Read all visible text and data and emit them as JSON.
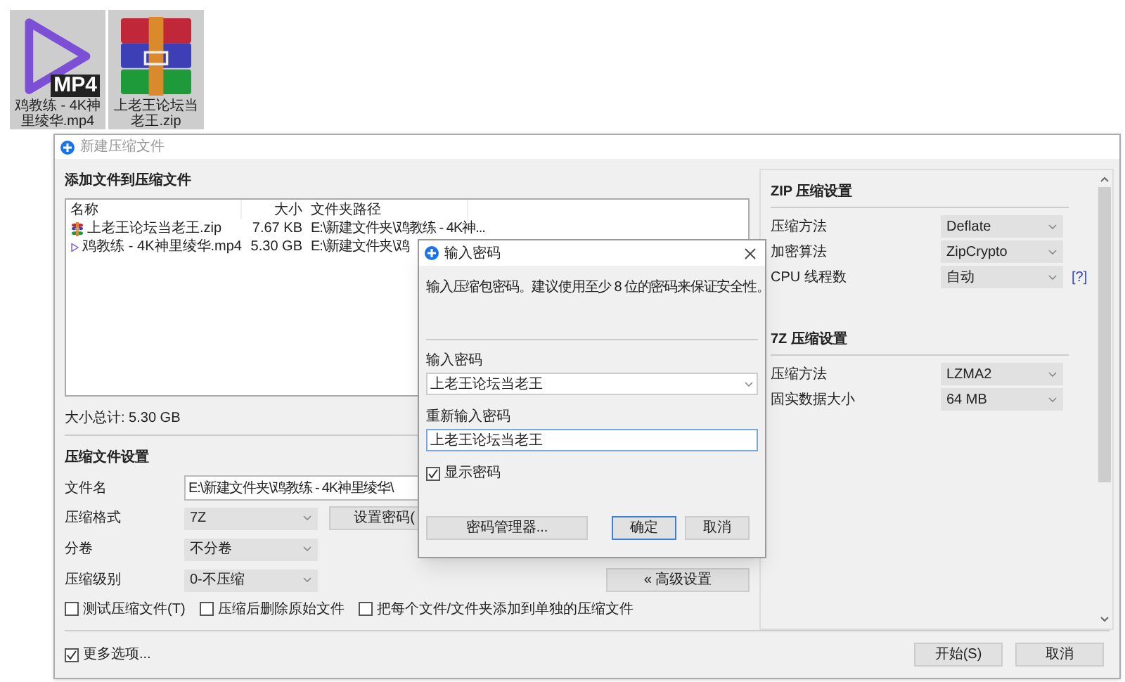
{
  "desktop_icons": [
    {
      "kind": "video",
      "badge": "MP4",
      "label": "鸡教练 - 4K神里绫华.mp4"
    },
    {
      "kind": "archive",
      "label": "上老王论坛当老王.zip"
    }
  ],
  "window": {
    "title": "新建压缩文件",
    "active": false
  },
  "files": {
    "heading": "添加文件到压缩文件",
    "columns": [
      "名称",
      "大小",
      "文件夹路径"
    ],
    "rows": [
      {
        "kind": "archive",
        "name": "上老王论坛当老王.zip",
        "size": "7.67 KB",
        "path": "E:\\新建文件夹\\鸡教练 - 4K神..."
      },
      {
        "kind": "video",
        "name": "鸡教练 - 4K神里绫华.mp4",
        "size": "5.30 GB",
        "path": "E:\\新建文件夹\\鸡"
      }
    ],
    "total": "大小总计: 5.30 GB"
  },
  "archive_settings": {
    "heading": "压缩文件设置",
    "filename_label": "文件名",
    "filename": "E:\\新建文件夹\\鸡教练 - 4K神里绫华\\",
    "selects": [
      {
        "label": "压缩格式",
        "value": "7Z"
      },
      {
        "label": "分卷",
        "value": "不分卷"
      },
      {
        "label": "压缩级别",
        "value": "0-不压缩"
      }
    ],
    "password_button": "设置密码(",
    "advanced_button": "« 高级设置",
    "options": [
      {
        "label": "测试压缩文件(T)",
        "checked": false
      },
      {
        "label": "压缩后删除原始文件",
        "checked": false
      },
      {
        "label": "把每个文件/文件夹添加到单独的压缩文件",
        "checked": false
      }
    ]
  },
  "more_options": {
    "label": "更多选项...",
    "checked": true
  },
  "right_panel": {
    "sections": [
      {
        "heading": "ZIP 压缩设置",
        "rows": [
          {
            "label": "压缩方法",
            "value": "Deflate"
          },
          {
            "label": "加密算法",
            "value": "ZipCrypto"
          },
          {
            "label": "CPU 线程数",
            "value": "自动",
            "help": "[?]"
          }
        ]
      },
      {
        "heading": "7Z 压缩设置",
        "rows": [
          {
            "label": "压缩方法",
            "value": "LZMA2"
          },
          {
            "label": "固实数据大小",
            "value": "64 MB"
          }
        ]
      }
    ]
  },
  "buttons": [
    {
      "label": "开始(S)"
    },
    {
      "label": "取消"
    }
  ],
  "dialog": {
    "title": "输入密码",
    "message": "输入压缩包密码。建议使用至少 8 位的密码来保证安全性。",
    "password_label": "输入密码",
    "password": "上老王论坛当老王",
    "confirm_label": "重新输入密码",
    "confirm": "上老王论坛当老王",
    "show_password": {
      "label": "显示密码",
      "checked": true
    },
    "buttons": [
      {
        "label": "密码管理器...",
        "default": false
      },
      {
        "label": "确定",
        "default": true
      },
      {
        "label": "取消",
        "default": false
      }
    ]
  }
}
